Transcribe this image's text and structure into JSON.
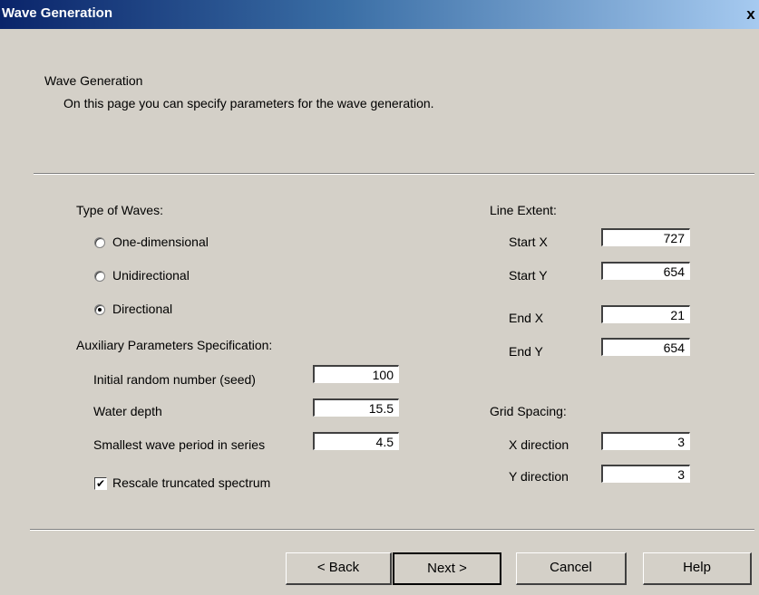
{
  "window": {
    "title": "Wave Generation",
    "close_glyph": "x"
  },
  "header": {
    "title": "Wave Generation",
    "description": "On this page you can specify parameters for the wave generation."
  },
  "type_of_waves": {
    "label": "Type of Waves:",
    "options": [
      {
        "label": "One-dimensional",
        "selected": false
      },
      {
        "label": "Unidirectional",
        "selected": false
      },
      {
        "label": "Directional",
        "selected": true
      }
    ]
  },
  "auxiliary": {
    "label": "Auxiliary Parameters Specification:",
    "seed": {
      "label": "Initial random number (seed)",
      "value": "100"
    },
    "water_depth": {
      "label": "Water depth",
      "value": "15.5"
    },
    "smallest_period": {
      "label": "Smallest wave period in series",
      "value": "4.5"
    },
    "rescale": {
      "label": "Rescale truncated spectrum",
      "checked": true,
      "mark": "✔"
    }
  },
  "line_extent": {
    "label": "Line Extent:",
    "start_x": {
      "label": "Start X",
      "value": "727"
    },
    "start_y": {
      "label": "Start Y",
      "value": "654"
    },
    "end_x": {
      "label": "End X",
      "value": "21"
    },
    "end_y": {
      "label": "End Y",
      "value": "654"
    }
  },
  "grid_spacing": {
    "label": "Grid Spacing:",
    "x_direction": {
      "label": "X direction",
      "value": "3"
    },
    "y_direction": {
      "label": "Y direction",
      "value": "3"
    }
  },
  "buttons": {
    "back": "< Back",
    "next": "Next >",
    "cancel": "Cancel",
    "help": "Help"
  }
}
